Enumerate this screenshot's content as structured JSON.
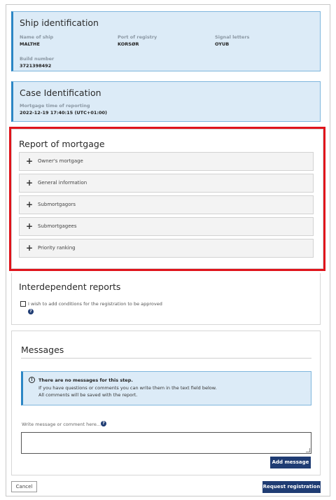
{
  "ship": {
    "title": "Ship identification",
    "name_label": "Name of ship",
    "name_value": "MALTHE",
    "port_label": "Port of registry",
    "port_value": "KORSØR",
    "signal_label": "Signal letters",
    "signal_value": "OYUB",
    "build_label": "Build number",
    "build_value": "3721398492"
  },
  "case": {
    "title": "Case Identification",
    "time_label": "Mortgage time of reporting",
    "time_value": "2022-12-19 17:40:15 (UTC+01:00)"
  },
  "report": {
    "title": "Report of mortgage",
    "items": [
      {
        "label": "Owner's mortgage"
      },
      {
        "label": "General information"
      },
      {
        "label": "Submortgagors"
      },
      {
        "label": "Submortgagees"
      },
      {
        "label": "Priority ranking"
      }
    ]
  },
  "interdependent": {
    "title": "Interdependent reports",
    "checkbox_label": "I wish to add conditions for the registration to be approved",
    "checked": false
  },
  "messages": {
    "title": "Messages",
    "info_title": "There are no messages for this step.",
    "info_line1": "If you have questions or comments you can write them in the text field below.",
    "info_line2": "All comments will be saved with the report.",
    "input_label": "Write message or comment here...",
    "input_value": "",
    "add_button": "Add message"
  },
  "footer": {
    "cancel": "Cancel",
    "request": "Request registration"
  },
  "colors": {
    "info_bg": "#dcebf7",
    "info_border": "#2b86c5",
    "primary": "#1f3c73",
    "highlight": "#e0141b"
  }
}
